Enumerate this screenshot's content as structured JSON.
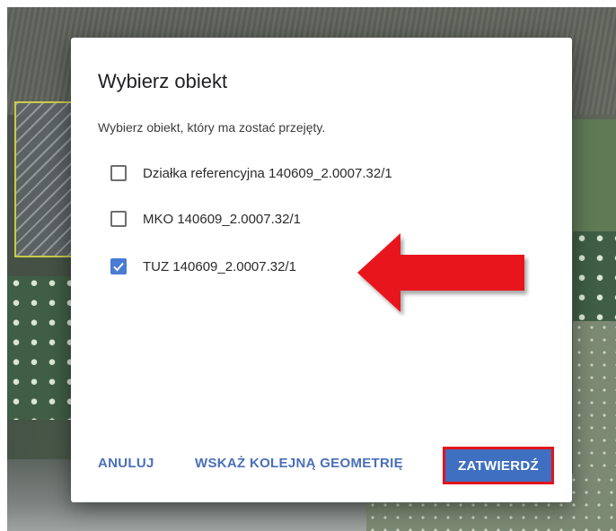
{
  "dialog": {
    "title": "Wybierz obiekt",
    "subtitle": "Wybierz obiekt, który ma zostać przejęty.",
    "options": [
      {
        "label": "Działka referencyjna 140609_2.0007.32/1",
        "checked": false
      },
      {
        "label": "MKO 140609_2.0007.32/1",
        "checked": false
      },
      {
        "label": "TUZ 140609_2.0007.32/1",
        "checked": true
      }
    ],
    "actions": {
      "cancel": "ANULUJ",
      "next_geometry": "WSKAŻ KOLEJNĄ GEOMETRIĘ",
      "confirm": "ZATWIERDŹ"
    }
  },
  "colors": {
    "accent": "#3f6fc1",
    "checkbox_checked": "#4a7bd5",
    "text_button": "#4a6fb8",
    "highlight_red": "#e3141b"
  },
  "annotations": {
    "arrow_icon": "red-arrow-left-icon"
  }
}
